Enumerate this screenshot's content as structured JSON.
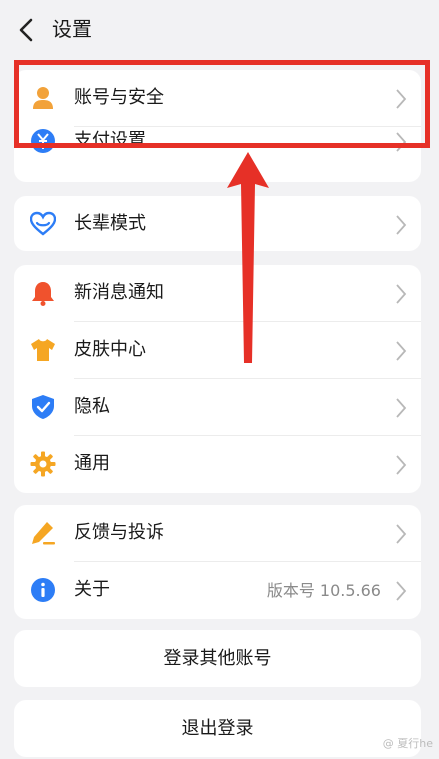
{
  "header": {
    "title": "设置",
    "back_icon": "chevron-left-icon"
  },
  "colors": {
    "user": "#f2a23a",
    "pay": "#2d7df6",
    "heart": "#2d7df6",
    "bell": "#f0522d",
    "shirt": "#f5a623",
    "shield": "#2d7df6",
    "gear": "#f5a623",
    "pen": "#f5a623",
    "info": "#2d7df6",
    "highlight": "#e63027"
  },
  "groups": {
    "account": [
      {
        "label": "账号与安全",
        "icon": "user-icon"
      },
      {
        "label": "支付设置",
        "icon": "yen-icon"
      }
    ],
    "elder": [
      {
        "label": "长辈模式",
        "icon": "heart-icon"
      }
    ],
    "general": [
      {
        "label": "新消息通知",
        "icon": "bell-icon"
      },
      {
        "label": "皮肤中心",
        "icon": "shirt-icon"
      },
      {
        "label": "隐私",
        "icon": "shield-check-icon"
      },
      {
        "label": "通用",
        "icon": "gear-icon"
      }
    ],
    "about": [
      {
        "label": "反馈与投诉",
        "icon": "edit-pen-icon"
      },
      {
        "label": "关于",
        "icon": "info-icon",
        "value": "版本号 10.5.66"
      }
    ]
  },
  "buttons": {
    "switch_account": "登录其他账号",
    "logout": "退出登录"
  },
  "watermark": "@ 夏行he"
}
